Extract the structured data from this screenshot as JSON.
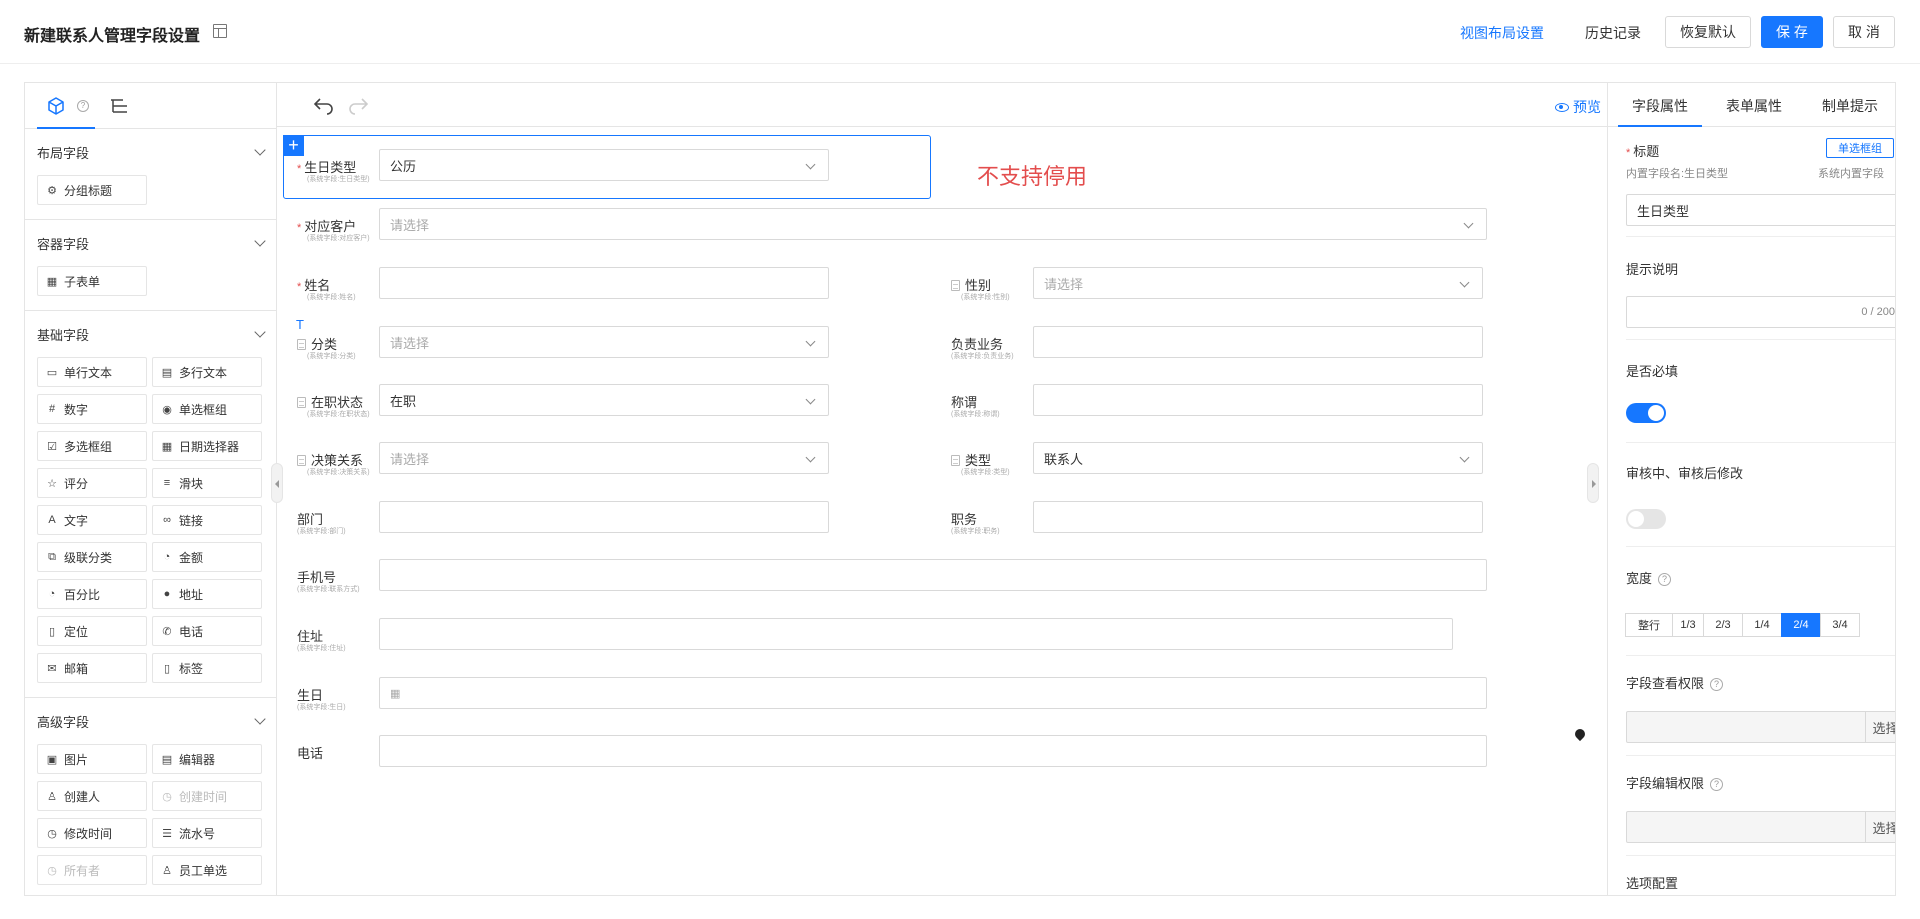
{
  "header": {
    "title": "新建联系人管理字段设置",
    "links": {
      "view_layout": "视图布局设置",
      "history": "历史记录"
    },
    "buttons": {
      "restore": "恢复默认",
      "save": "保 存",
      "cancel": "取 消"
    }
  },
  "left": {
    "sections": [
      {
        "title": "布局字段",
        "items": [
          {
            "label": "分组标题",
            "icon": "group-title-icon"
          }
        ]
      },
      {
        "title": "容器字段",
        "items": [
          {
            "label": "子表单",
            "icon": "table-icon"
          }
        ]
      },
      {
        "title": "基础字段",
        "items": [
          {
            "label": "单行文本",
            "icon": "single-line-icon"
          },
          {
            "label": "多行文本",
            "icon": "multi-line-icon"
          },
          {
            "label": "数字",
            "icon": "number-icon"
          },
          {
            "label": "单选框组",
            "icon": "radio-icon"
          },
          {
            "label": "多选框组",
            "icon": "checkbox-icon"
          },
          {
            "label": "日期选择器",
            "icon": "calendar-icon"
          },
          {
            "label": "评分",
            "icon": "star-icon"
          },
          {
            "label": "滑块",
            "icon": "slider-icon"
          },
          {
            "label": "文字",
            "icon": "text-icon"
          },
          {
            "label": "链接",
            "icon": "link-icon"
          },
          {
            "label": "级联分类",
            "icon": "cascade-icon"
          },
          {
            "label": "金额",
            "icon": "amount-icon"
          },
          {
            "label": "百分比",
            "icon": "percent-icon"
          },
          {
            "label": "地址",
            "icon": "location-pin-icon"
          },
          {
            "label": "定位",
            "icon": "locate-doc-icon"
          },
          {
            "label": "电话",
            "icon": "phone-icon"
          },
          {
            "label": "邮箱",
            "icon": "mail-icon"
          },
          {
            "label": "标签",
            "icon": "tag-icon"
          }
        ]
      },
      {
        "title": "高级字段",
        "items": [
          {
            "label": "图片",
            "icon": "image-icon"
          },
          {
            "label": "编辑器",
            "icon": "editor-icon"
          },
          {
            "label": "创建人",
            "icon": "user-icon"
          },
          {
            "label": "创建时间",
            "icon": "clock-icon",
            "disabled": true
          },
          {
            "label": "修改时间",
            "icon": "clock-icon"
          },
          {
            "label": "流水号",
            "icon": "serial-icon"
          },
          {
            "label": "所有者",
            "icon": "owner-icon",
            "disabled": true
          },
          {
            "label": "员工单选",
            "icon": "employee-icon"
          }
        ]
      }
    ]
  },
  "center": {
    "preview": "预览",
    "annotation": "不支持停用",
    "t_mark": "T",
    "fields": {
      "birthday_type": {
        "label": "生日类型",
        "sub": "(系统字段:生日类型)",
        "value": "公历"
      },
      "customer": {
        "label": "对应客户",
        "sub": "(系统字段:对应客户)",
        "placeholder": "请选择"
      },
      "name": {
        "label": "姓名",
        "sub": "(系统字段:姓名)"
      },
      "gender": {
        "label": "性别",
        "sub": "(系统字段:性别)",
        "placeholder": "请选择"
      },
      "category": {
        "label": "分类",
        "sub": "(系统字段:分类)",
        "placeholder": "请选择"
      },
      "business": {
        "label": "负责业务",
        "sub": "(系统字段:负责业务)"
      },
      "status": {
        "label": "在职状态",
        "sub": "(系统字段:在职状态)",
        "value": "在职"
      },
      "title_field": {
        "label": "称谓",
        "sub": "(系统字段:称谓)"
      },
      "decision": {
        "label": "决策关系",
        "sub": "(系统字段:决策关系)",
        "placeholder": "请选择"
      },
      "type": {
        "label": "类型",
        "sub": "(系统字段:类型)",
        "value": "联系人"
      },
      "dept": {
        "label": "部门",
        "sub": "(系统字段:部门)"
      },
      "position": {
        "label": "职务",
        "sub": "(系统字段:职务)"
      },
      "mobile": {
        "label": "手机号",
        "sub": "(系统字段:联系方式)"
      },
      "address": {
        "label": "住址",
        "sub": "(系统字段:住址)"
      },
      "birthday": {
        "label": "生日",
        "sub": "(系统字段:生日)"
      },
      "phone": {
        "label": "电话"
      }
    }
  },
  "right": {
    "tabs": [
      "字段属性",
      "表单属性",
      "制单提示"
    ],
    "title_label": "标题",
    "tag": "单选框组",
    "builtin_name": "内置字段名:生日类型",
    "system_builtin": "系统内置字段",
    "title_value": "生日类型",
    "hint_label": "提示说明",
    "counter": "0 / 200",
    "required_label": "是否必填",
    "required_on": true,
    "review_label": "审核中、审核后修改",
    "review_on": false,
    "width_label": "宽度",
    "width_options": [
      "整行",
      "1/3",
      "2/3",
      "1/4",
      "2/4",
      "3/4"
    ],
    "width_selected": "2/4",
    "view_perm_label": "字段查看权限",
    "edit_perm_label": "字段编辑权限",
    "select": "选择",
    "options_label": "选项配置",
    "help_glyph": "?"
  },
  "colors": {
    "accent": "#1677ff",
    "required": "#e34d4d"
  }
}
